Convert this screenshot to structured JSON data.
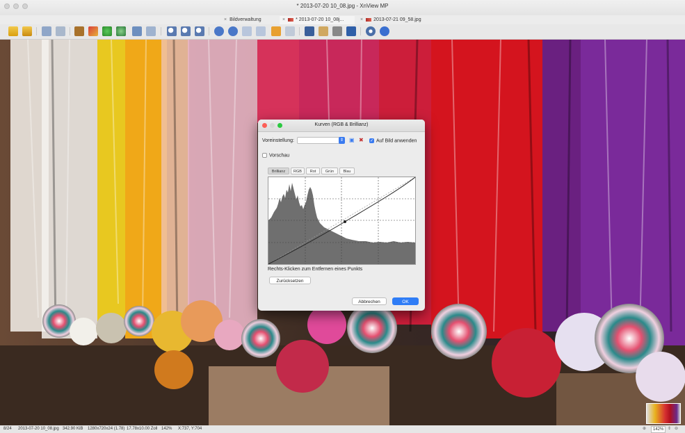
{
  "window": {
    "title": "* 2013-07-20 10_08.jpg - XnView MP"
  },
  "tabs": [
    {
      "label": "Bildverwaltung",
      "close": "×"
    },
    {
      "label": "* 2013-07-20 10_08j...",
      "close": "×"
    },
    {
      "label": "2013-07-21 09_58.jpg",
      "close": "×"
    }
  ],
  "toolbar": {
    "icons": [
      "browser-icon",
      "fullscreen-icon",
      "rotate-left-icon",
      "rotate-right-icon",
      "crop-icon",
      "resize-icon",
      "color-icon",
      "adjust-icon",
      "image-settings-icon",
      "edit-icon",
      "zoom-in-icon",
      "zoom-fit-icon",
      "zoom-out-icon",
      "prev-icon",
      "next-icon",
      "first-icon",
      "last-icon",
      "slideshow-icon",
      "view-icon",
      "fit-window-icon",
      "paint-icon",
      "print-icon",
      "save-icon",
      "settings-icon",
      "help-icon"
    ]
  },
  "dialog": {
    "title": "Kurven (RGB & Brillianz)",
    "preset_label": "Voreinstellung:",
    "apply_label": "Auf Bild anwenden",
    "preview_label": "Vorschau",
    "channels": [
      "Brillianz",
      "RGB",
      "Rot",
      "Grün",
      "Blau"
    ],
    "active_channel": "Brillianz",
    "hint": "Rechts-Klicken zum Entfernen eines Punkts",
    "reset_label": "Zurücksetzen",
    "cancel_label": "Abbrechen",
    "ok_label": "OK"
  },
  "status": {
    "index": "8/24",
    "file": "2013-07-20 10_08.jpg",
    "size": "342.90 KiB",
    "dimensions": "1280x720x24 (1.78)",
    "print_size": "17.78x10.00 Zoll",
    "zoom": "142%",
    "coords": "X:737, Y:704",
    "zoom_right": "142%"
  },
  "colors": {
    "accent": "#2f7df6",
    "histogram": "#6f6f6f"
  }
}
